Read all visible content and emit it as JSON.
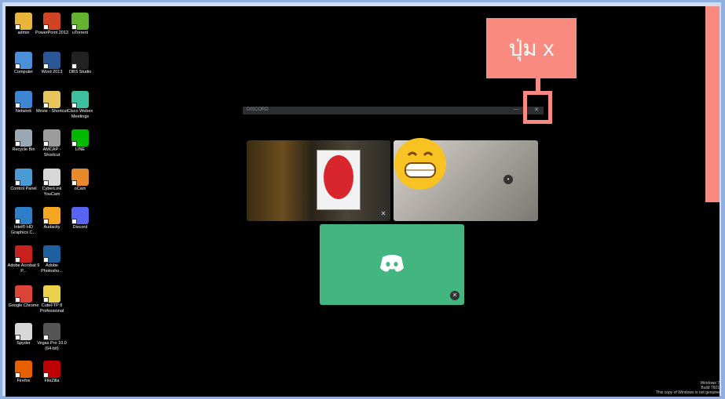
{
  "desktop_icons": [
    {
      "label": "admin",
      "icon": "user-folder-icon",
      "color": "#e8b63a"
    },
    {
      "label": "PowerPoint 2013",
      "icon": "powerpoint-icon",
      "color": "#d04423"
    },
    {
      "label": "uTorrent",
      "icon": "utorrent-icon",
      "color": "#63b330"
    },
    {
      "label": "Computer",
      "icon": "computer-icon",
      "color": "#4a8fd8"
    },
    {
      "label": "Word 2013",
      "icon": "word-icon",
      "color": "#2b5797"
    },
    {
      "label": "OBS Studio",
      "icon": "obs-icon",
      "color": "#222222"
    },
    {
      "label": "Network",
      "icon": "network-icon",
      "color": "#3e86d1"
    },
    {
      "label": "Movie - Shortcut",
      "icon": "movie-folder-icon",
      "color": "#e8c55a"
    },
    {
      "label": "Cisco Webex Meetings",
      "icon": "webex-icon",
      "color": "#3dbfa0"
    },
    {
      "label": "Recycle Bin",
      "icon": "recycle-bin-icon",
      "color": "#9aa8b4"
    },
    {
      "label": "AMCAP - Shortcut",
      "icon": "amcap-icon",
      "color": "#9c9c9c"
    },
    {
      "label": "LINE",
      "icon": "line-icon",
      "color": "#00b900"
    },
    {
      "label": "Control Panel",
      "icon": "control-panel-icon",
      "color": "#4a9ad4"
    },
    {
      "label": "CyberLink YouCam",
      "icon": "youcam-icon",
      "color": "#d8d8d8"
    },
    {
      "label": "oCam",
      "icon": "ocam-icon",
      "color": "#e88a2a"
    },
    {
      "label": "Intel® HD Graphics C...",
      "icon": "intel-graphics-icon",
      "color": "#2f7fc8"
    },
    {
      "label": "Audacity",
      "icon": "audacity-icon",
      "color": "#f5a623"
    },
    {
      "label": "Discord",
      "icon": "discord-icon",
      "color": "#5865f2"
    },
    {
      "label": "Adobe Acrobat 9 P...",
      "icon": "acrobat-icon",
      "color": "#c8201d"
    },
    {
      "label": "Adobe Photosho...",
      "icon": "photoshop-icon",
      "color": "#1e5fa0"
    },
    {
      "label": "Google Chrome",
      "icon": "chrome-icon",
      "color": "#db4437"
    },
    {
      "label": "CuteFTP 8 Professional",
      "icon": "cuteftp-icon",
      "color": "#e9d24a"
    },
    {
      "label": "Spyder",
      "icon": "spyder-icon",
      "color": "#d8d8d8"
    },
    {
      "label": "Vegas Pro 10.0 (64-bit)",
      "icon": "vegas-icon",
      "color": "#555555"
    },
    {
      "label": "Firefox",
      "icon": "firefox-icon",
      "color": "#e66000"
    },
    {
      "label": "FileZilla",
      "icon": "filezilla-icon",
      "color": "#bf0000"
    }
  ],
  "callout": {
    "label": "ปุ่ม x"
  },
  "discord_window": {
    "title": "DISCORD",
    "minimize": "—",
    "close": "✕"
  },
  "watermark": {
    "line1": "Windows 7",
    "line2": "Build 7601",
    "line3": "This copy of Windows is not genuine"
  }
}
